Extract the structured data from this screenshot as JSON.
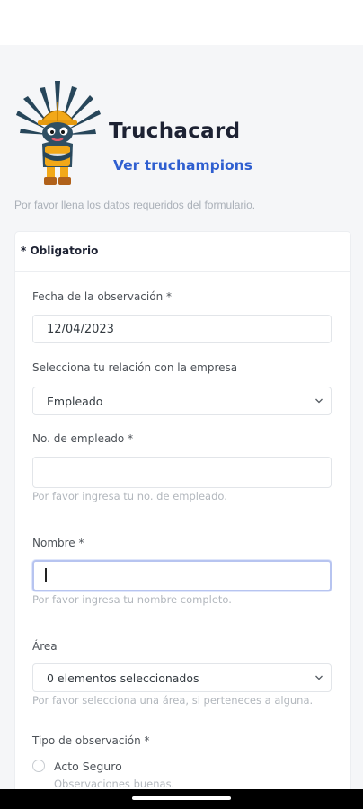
{
  "header": {
    "app_name": "Truchacard",
    "link_label": "Ver truchampions"
  },
  "intro": "Por favor llena los datos requeridos del formulario.",
  "form": {
    "required_note": "* Obligatorio",
    "date": {
      "label": "Fecha de la observación *",
      "value": "12/04/2023"
    },
    "relation": {
      "label": "Selecciona tu relación con la empresa",
      "value": "Empleado"
    },
    "employee_number": {
      "label": "No. de empleado *",
      "value": "",
      "help": "Por favor ingresa tu no. de empleado."
    },
    "name": {
      "label": "Nombre *",
      "value": "",
      "help": "Por favor ingresa tu nombre completo."
    },
    "area": {
      "label": "Área",
      "value": "0 elementos seleccionados",
      "help": "Por favor selecciona una área, si perteneces a alguna."
    },
    "observation_type": {
      "label": "Tipo de observación *",
      "options": [
        {
          "label": "Acto Seguro",
          "help": "Observaciones buenas."
        }
      ]
    }
  },
  "icons": {
    "mascot": "agave-mascot-icon",
    "chevron": "chevron-down-icon"
  },
  "colors": {
    "accent": "#2f5fd0",
    "background": "#f5f6f8",
    "mascot_leaves": "#27465a",
    "helmet": "#f2a818"
  }
}
